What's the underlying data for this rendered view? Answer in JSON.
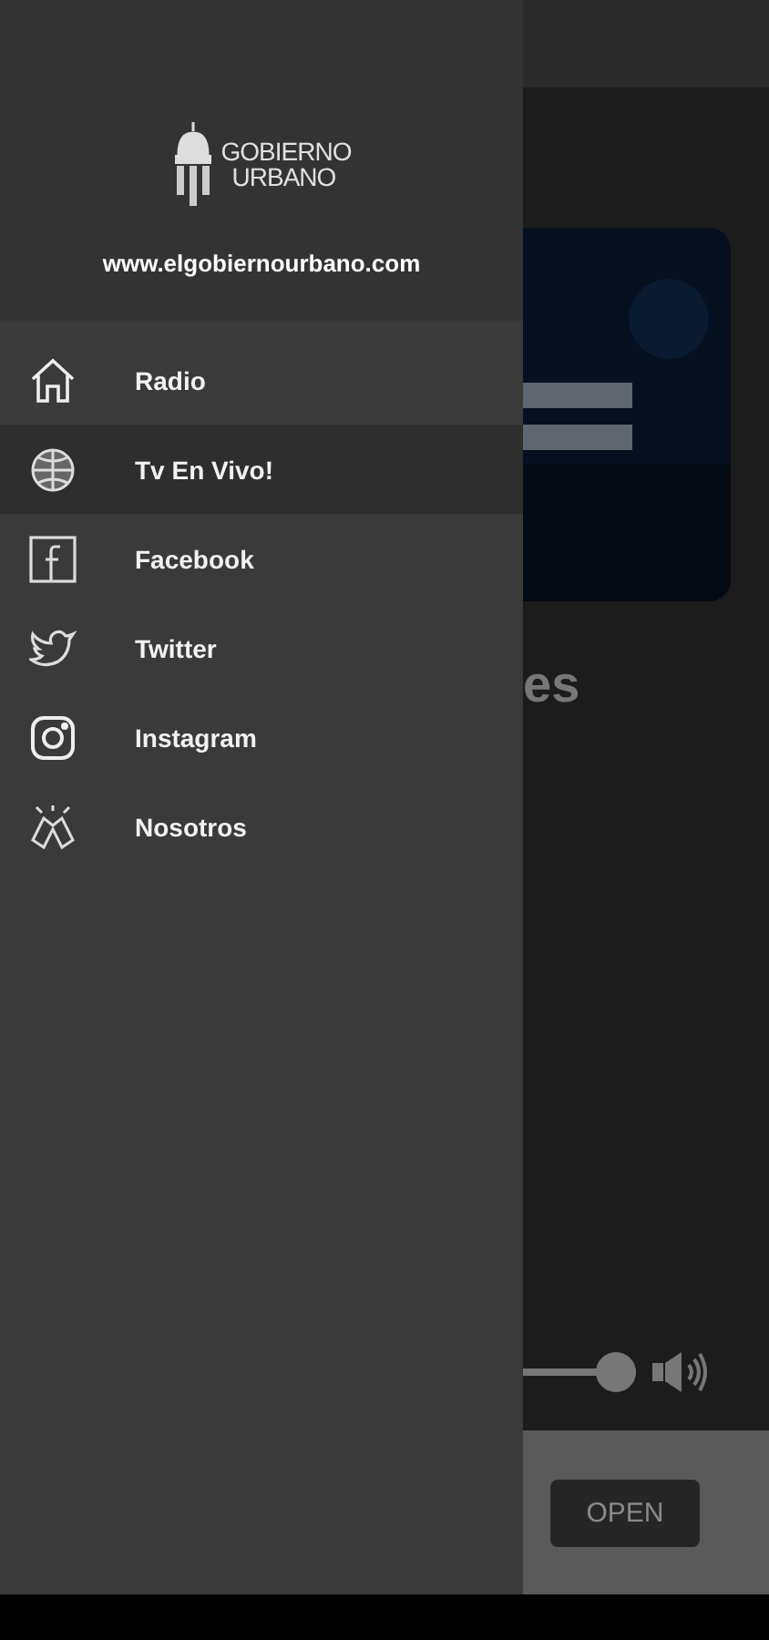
{
  "drawer": {
    "logo": {
      "line_1": "GOBIERNO",
      "line_2": "URBANO"
    },
    "website": "www.elgobiernourbano.com",
    "items": [
      {
        "label": "Radio",
        "kind": "home",
        "selected": false
      },
      {
        "label": "Tv En Vivo!",
        "kind": "live",
        "selected": true
      },
      {
        "label": "Facebook",
        "kind": "facebook",
        "selected": false
      },
      {
        "label": "Twitter",
        "kind": "twitter",
        "selected": false
      },
      {
        "label": "Instagram",
        "kind": "instagram",
        "selected": false
      },
      {
        "label": "Nosotros",
        "kind": "about",
        "selected": false
      }
    ]
  },
  "background": {
    "title": "es",
    "volume": {
      "level": 0.82
    },
    "ad": {
      "button": "OPEN"
    }
  }
}
